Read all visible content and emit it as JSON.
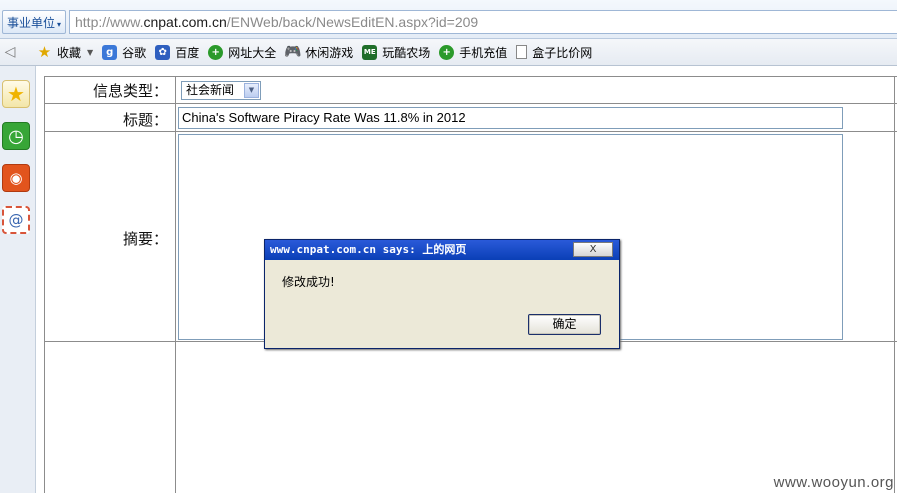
{
  "address_bar": {
    "zone_label": "事业单位",
    "url_prefix": "http://www.",
    "url_domain": "cnpat.com.cn",
    "url_path": "/ENWeb/back/NewsEditEN.aspx?id=209"
  },
  "bookmarks": [
    {
      "label": "收藏",
      "icon": "star-icon"
    },
    {
      "label": "谷歌",
      "icon": "google-icon"
    },
    {
      "label": "百度",
      "icon": "baidu-icon"
    },
    {
      "label": "网址大全",
      "icon": "plus-icon"
    },
    {
      "label": "休闲游戏",
      "icon": "gamepad-icon"
    },
    {
      "label": "玩酷农场",
      "icon": "me-icon"
    },
    {
      "label": "手机充值",
      "icon": "plus-icon"
    },
    {
      "label": "盒子比价网",
      "icon": "page-icon"
    }
  ],
  "sidebar": {
    "items": [
      {
        "icon": "favorites-star-icon"
      },
      {
        "icon": "history-clock-icon"
      },
      {
        "icon": "weibo-icon"
      },
      {
        "icon": "mail-icon"
      }
    ]
  },
  "form": {
    "type_label": "信息类型：",
    "type_value": "社会新闻",
    "title_label": "标题：",
    "title_value": "China's Software Piracy Rate Was 11.8% in 2012",
    "summary_label": "摘要：",
    "summary_value": ""
  },
  "dialog": {
    "title": "www.cnpat.com.cn says: 上的网页",
    "close_label": "X",
    "message": "修改成功!",
    "ok_label": "确定"
  },
  "watermark": "www.wooyun.org"
}
